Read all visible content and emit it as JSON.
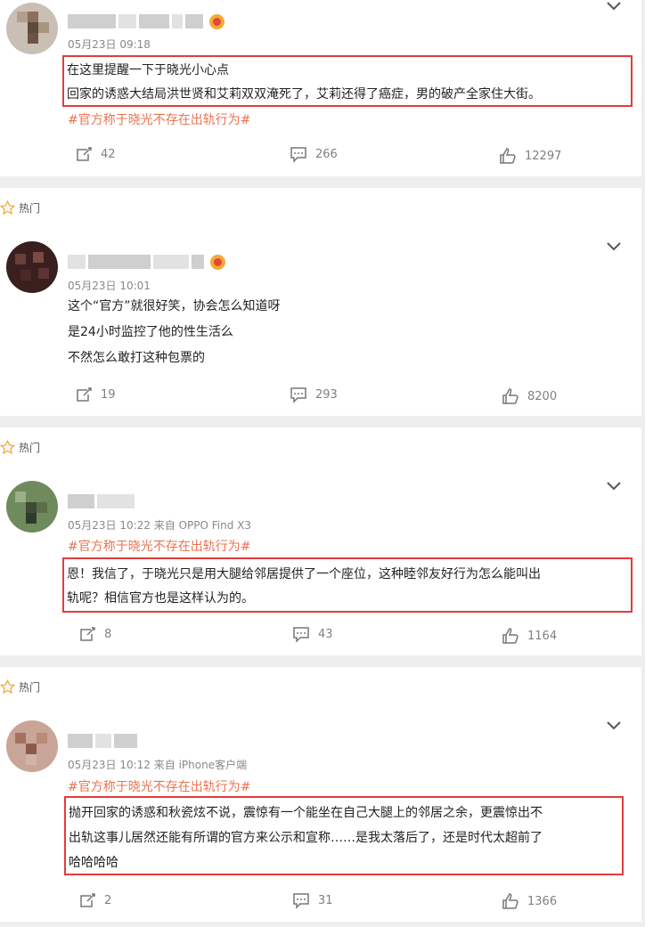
{
  "comments": [
    {
      "hot_label": "",
      "time": "05月23日 09:18",
      "lines": [
        "在这里提醒一下于晓光小心点",
        "回家的诱惑大结局洪世贤和艾莉双双淹死了，艾莉还得了癌症，男的破产全家住大街。"
      ],
      "topic": "#官方称于晓光不存在出轨行为#",
      "share": "42",
      "comment": "266",
      "like": "12297"
    },
    {
      "hot_label": "热门",
      "time": "05月23日 10:01",
      "lines": [
        "这个“官方”就很好笑，协会怎么知道呀",
        "是24小时监控了他的性生活么",
        "不然怎么敢打这种包票的"
      ],
      "topic": "",
      "share": "19",
      "comment": "293",
      "like": "8200"
    },
    {
      "hot_label": "热门",
      "time": "05月23日 10:22  来自 OPPO Find X3",
      "topic": "#官方称于晓光不存在出轨行为#",
      "lines": [
        "恩！我信了，于晓光只是用大腿给邻居提供了一个座位，这种睦邻友好行为怎么能叫出",
        "轨呢？相信官方也是这样认为的。"
      ],
      "share": "8",
      "comment": "43",
      "like": "1164"
    },
    {
      "hot_label": "热门",
      "time": "05月23日 10:12  来自 iPhone客户端",
      "topic": "#官方称于晓光不存在出轨行为#",
      "lines": [
        "抛开回家的诱惑和秋瓷炫不说，震惊有一个能坐在自己大腿上的邻居之余，更震惊出不",
        "出轨这事儿居然还能有所谓的官方来公示和宣称……是我太落后了，还是时代太超前了",
        "哈哈哈哈"
      ],
      "share": "2",
      "comment": "31",
      "like": "1366"
    }
  ],
  "colors": {
    "topic": "#eb7350",
    "highlight_box": "#e23c3c",
    "page_bg": "#eeeeee"
  },
  "icons": [
    "star-icon",
    "chevron-down-icon",
    "share-icon",
    "comment-icon",
    "like-icon",
    "vip-badge-icon"
  ]
}
